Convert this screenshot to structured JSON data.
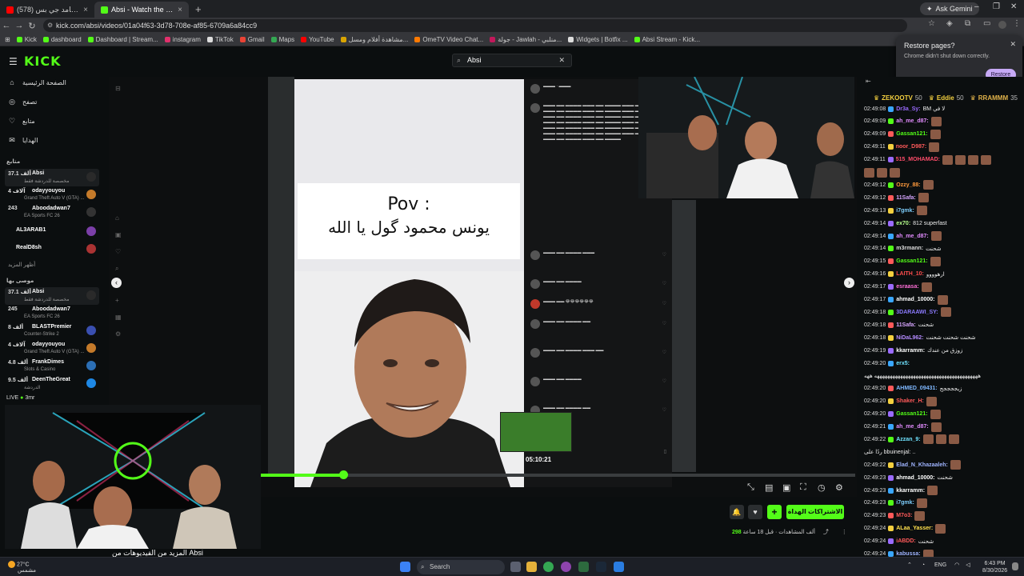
{
  "browser": {
    "tabs": [
      {
        "title": "مهرجان انا اصلا جامد جي بس (578)",
        "color": "#ff0000"
      },
      {
        "title": "Absi - Watch the VOD on Kick",
        "color": "#53fc18"
      }
    ],
    "new_tab": "+",
    "ask_gemini": "Ask Gemini",
    "url": "kick.com/absi/videos/01a04f63-3d78-708e-af85-6709a6a84cc9",
    "bookmarks": [
      "Kick",
      "dashboard",
      "Dashboard | Stream...",
      "instagram",
      "TikTok",
      "Gmail",
      "Maps",
      "YouTube",
      "مشاهدة أفلام ومسل...",
      "OmeTV Video Chat...",
      "جولة - Jawlah - منلبي...",
      "Widgets | Botfix ...",
      "Absi Stream - Kick..."
    ]
  },
  "restore_popup": {
    "title": "Restore pages?",
    "body": "Chrome didn't shut down correctly.",
    "button": "Restore"
  },
  "kick": {
    "logo": "KICK",
    "search_value": "Absi",
    "nav": [
      "الصفحة الرئيسية",
      "تصفح",
      "متابع",
      "الهدايا"
    ],
    "following_header": "متابع",
    "following": [
      {
        "viewers": "37.1 ألف",
        "name": "Absi",
        "game": "مخصصة للدردشة فقط",
        "sel": true
      },
      {
        "viewers": "4 آلاف",
        "name": "odayyouyou",
        "game": "Grand Theft Auto V (GTA) ..."
      },
      {
        "viewers": "243",
        "name": "Aboodadwan7",
        "game": "EA Sports FC 26"
      },
      {
        "viewers": "",
        "name": "AL3ARAB1",
        "game": ""
      },
      {
        "viewers": "",
        "name": "RealD8sh",
        "game": ""
      }
    ],
    "show_more": "أظهر المزيد",
    "recommended_header": "موصى بها",
    "recommended": [
      {
        "viewers": "37.1 ألف",
        "name": "Absi",
        "game": "مخصصة للدردشة فقط",
        "sel": true
      },
      {
        "viewers": "245",
        "name": "Aboodadwan7",
        "game": "EA Sports FC 26"
      },
      {
        "viewers": "8 ألف",
        "name": "BLASTPremier",
        "game": "Counter-Strike 2"
      },
      {
        "viewers": "4 آلاف",
        "name": "odayyouyou",
        "game": "Grand Theft Auto V (GTA) ..."
      },
      {
        "viewers": "4.8 ألف",
        "name": "FrankDimes",
        "game": "Slots & Casino"
      },
      {
        "viewers": "9.5 ألف",
        "name": "DeenTheGreat",
        "game": "الدردشة"
      }
    ],
    "live_label": "LIVE",
    "live_name": "3mr",
    "cam_caption": "المزيد من الفيديوهات من Absi"
  },
  "video": {
    "meme_line1": "Pov :",
    "meme_line2": "يونس محمود گول يا الله",
    "preview_time": "05:10:21",
    "progress": 0.14
  },
  "below_player": {
    "subscribe": "الاشتراكات الهداة",
    "views": "298",
    "views_label": "ألف المشاهدات",
    "time_ago": "قبل 18 ساعة"
  },
  "chat": {
    "gifters": [
      {
        "name": "ZEKOOTV",
        "count": "50",
        "color": "#f4d03f"
      },
      {
        "name": "Eddie",
        "count": "50",
        "color": "#f4d03f"
      },
      {
        "name": "RRAMMM",
        "count": "35",
        "color": "#e0b24a"
      }
    ],
    "messages": [
      {
        "ts": "02:49:08",
        "user": "Dr3a_Sy:",
        "color": "#9b6bff",
        "text": "BM لا في",
        "emotes": 0
      },
      {
        "ts": "02:49:09",
        "user": "ah_me_d87:",
        "color": "#e38cff",
        "text": "",
        "emotes": 1
      },
      {
        "ts": "02:49:09",
        "user": "Gassan121:",
        "color": "#53fc18",
        "text": "",
        "emotes": 1
      },
      {
        "ts": "02:49:11",
        "user": "noor_D987:",
        "color": "#ff5a5a",
        "text": "",
        "emotes": 1
      },
      {
        "ts": "02:49:11",
        "user": "515_MOHAMAD:",
        "color": "#ff4d6a",
        "text": "",
        "emotes": 4
      },
      {
        "ts": "",
        "user": "",
        "color": "#fff",
        "text": "",
        "emotes": 3
      },
      {
        "ts": "02:49:12",
        "user": "Ozzy_88:",
        "color": "#ff9a3c",
        "text": "",
        "emotes": 1
      },
      {
        "ts": "02:49:12",
        "user": "11Safa:",
        "color": "#d7a6ff",
        "text": "",
        "emotes": 1
      },
      {
        "ts": "02:49:13",
        "user": "i7gmk:",
        "color": "#7fd0ff",
        "text": "",
        "emotes": 1
      },
      {
        "ts": "02:49:14",
        "user": "ex70:",
        "color": "#b6ff8c",
        "text": "812 superfast",
        "emotes": 0
      },
      {
        "ts": "02:49:14",
        "user": "ah_me_d87:",
        "color": "#e38cff",
        "text": "",
        "emotes": 1
      },
      {
        "ts": "02:49:14",
        "user": "m3rmann:",
        "color": "#dddddd",
        "text": "شحنت",
        "emotes": 0
      },
      {
        "ts": "02:49:15",
        "user": "Gassan121:",
        "color": "#53fc18",
        "text": "",
        "emotes": 1
      },
      {
        "ts": "02:49:16",
        "user": "LAITH_10:",
        "color": "#ff4d4d",
        "text": "ارهوووو",
        "emotes": 0
      },
      {
        "ts": "02:49:17",
        "user": "esraasa:",
        "color": "#ff6fd8",
        "text": "",
        "emotes": 1
      },
      {
        "ts": "02:49:17",
        "user": "ahmad_10000:",
        "color": "#ffffff",
        "text": "",
        "emotes": 1
      },
      {
        "ts": "02:49:18",
        "user": "3DARAAWI_SY:",
        "color": "#8c7bff",
        "text": "",
        "emotes": 1
      },
      {
        "ts": "02:49:18",
        "user": "11Safa:",
        "color": "#d7a6ff",
        "text": "شحنت",
        "emotes": 0
      },
      {
        "ts": "02:49:18",
        "user": "NiDaL962:",
        "color": "#b48bff",
        "text": "شحنت شحنت شحنت",
        "emotes": 0
      },
      {
        "ts": "02:49:19",
        "user": "kkarramm:",
        "color": "#ffffff",
        "text": "زوزق من عندك",
        "emotes": 0
      },
      {
        "ts": "02:49:20",
        "user": "erx5:",
        "color": "#6fe3ff",
        "text": "",
        "emotes": 0
      },
      {
        "ts": "",
        "user": "",
        "color": "#fff",
        "text": "ههههههههههههههههههههههههههههههههههههههههه ههه",
        "emotes": 0
      },
      {
        "ts": "02:49:20",
        "user": "AHMED_09431:",
        "color": "#7fb8ff",
        "text": "زيججججج",
        "emotes": 0
      },
      {
        "ts": "02:49:20",
        "user": "Shaker_H:",
        "color": "#ff5a5a",
        "text": "",
        "emotes": 1
      },
      {
        "ts": "02:49:20",
        "user": "Gassan121:",
        "color": "#53fc18",
        "text": "",
        "emotes": 1
      },
      {
        "ts": "02:49:21",
        "user": "ah_me_d87:",
        "color": "#e38cff",
        "text": "",
        "emotes": 1
      },
      {
        "ts": "02:49:22",
        "user": "Azzan_9:",
        "color": "#6fe3ff",
        "text": "",
        "emotes": 3
      },
      {
        "ts": "",
        "user": "",
        "color": "#bbb",
        "text": "ردًا على bbuinenjal: ..",
        "emotes": 0
      },
      {
        "ts": "02:49:22",
        "user": "Elad_N_Khazaaleh:",
        "color": "#9fb4ff",
        "text": "",
        "emotes": 1
      },
      {
        "ts": "02:49:23",
        "user": "ahmad_10000:",
        "color": "#ffffff",
        "text": "شحنت",
        "emotes": 0
      },
      {
        "ts": "02:49:23",
        "user": "kkarramm:",
        "color": "#ffffff",
        "text": "",
        "emotes": 1
      },
      {
        "ts": "02:49:23",
        "user": "i7gmk:",
        "color": "#7fd0ff",
        "text": "",
        "emotes": 1
      },
      {
        "ts": "02:49:23",
        "user": "M7o3:",
        "color": "#ff5a5a",
        "text": "",
        "emotes": 1
      },
      {
        "ts": "02:49:24",
        "user": "ALaa_Yasser:",
        "color": "#ffe04d",
        "text": "",
        "emotes": 1
      },
      {
        "ts": "02:49:24",
        "user": "iABDD:",
        "color": "#ff5a5a",
        "text": "شحنت",
        "emotes": 0
      },
      {
        "ts": "02:49:24",
        "user": "kabussa:",
        "color": "#9fb4ff",
        "text": "",
        "emotes": 1
      }
    ]
  },
  "taskbar": {
    "temp": "27°C",
    "weather": "مشمس",
    "search": "Search",
    "lang": "ENG",
    "time": "6:43 PM",
    "date": "8/30/2026"
  }
}
